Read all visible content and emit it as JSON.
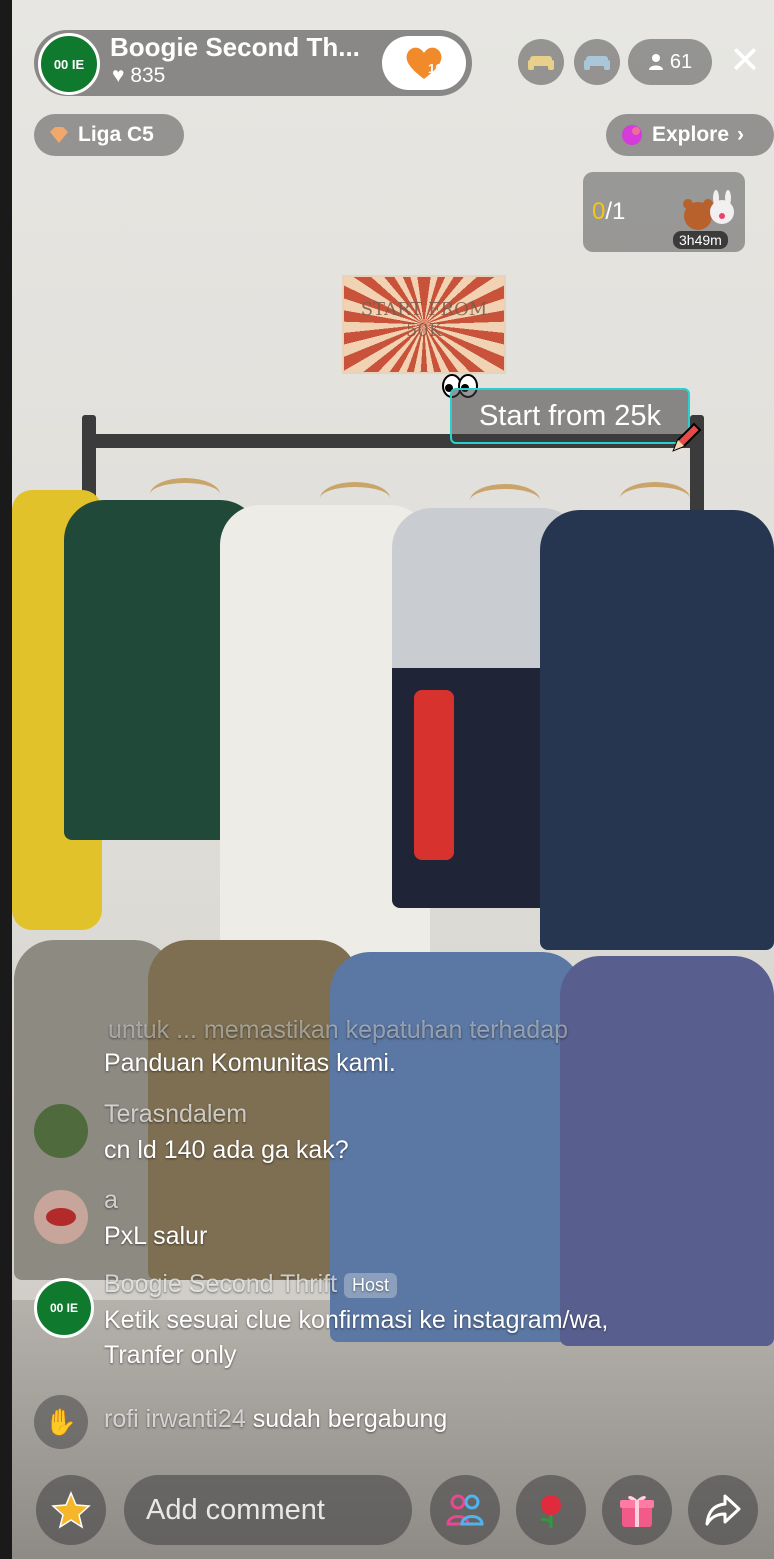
{
  "host": {
    "avatar_text": "00 IE",
    "name": "Boogie Second Th...",
    "likes": "835"
  },
  "gift_badge": {
    "count": "10"
  },
  "viewers": {
    "count": "61"
  },
  "league": {
    "label": "Liga C5"
  },
  "explore": {
    "label": "Explore"
  },
  "task": {
    "progress_current": "0",
    "progress_total": "/1",
    "timer": "3h49m"
  },
  "sign": {
    "text": "START FROM 50K"
  },
  "sticker": {
    "text": "Start from 25k"
  },
  "chat": {
    "notice_top": "untuk ... memastikan kepatuhan terhadap",
    "notice_bottom": "Panduan Komunitas kami.",
    "messages": [
      {
        "user": "Terasndalem",
        "text": "cn ld 140 ada ga kak?"
      },
      {
        "user": "a",
        "text": "PxL salur"
      },
      {
        "user": "Boogie Second Thrift",
        "tag": "Host",
        "text_line1": "Ketik sesuai clue konfirmasi ke instagram/wa,",
        "text_line2": "Tranfer only"
      }
    ],
    "join": {
      "user": "rofi irwanti24",
      "text": "sudah bergabung"
    }
  },
  "comment": {
    "placeholder": "Add comment"
  },
  "colors": {
    "accent_orange": "#f08a2b",
    "cyan_border": "#2ad0d0",
    "host_green": "#0f7a2e",
    "explore_gradient": "#d43bd9"
  }
}
